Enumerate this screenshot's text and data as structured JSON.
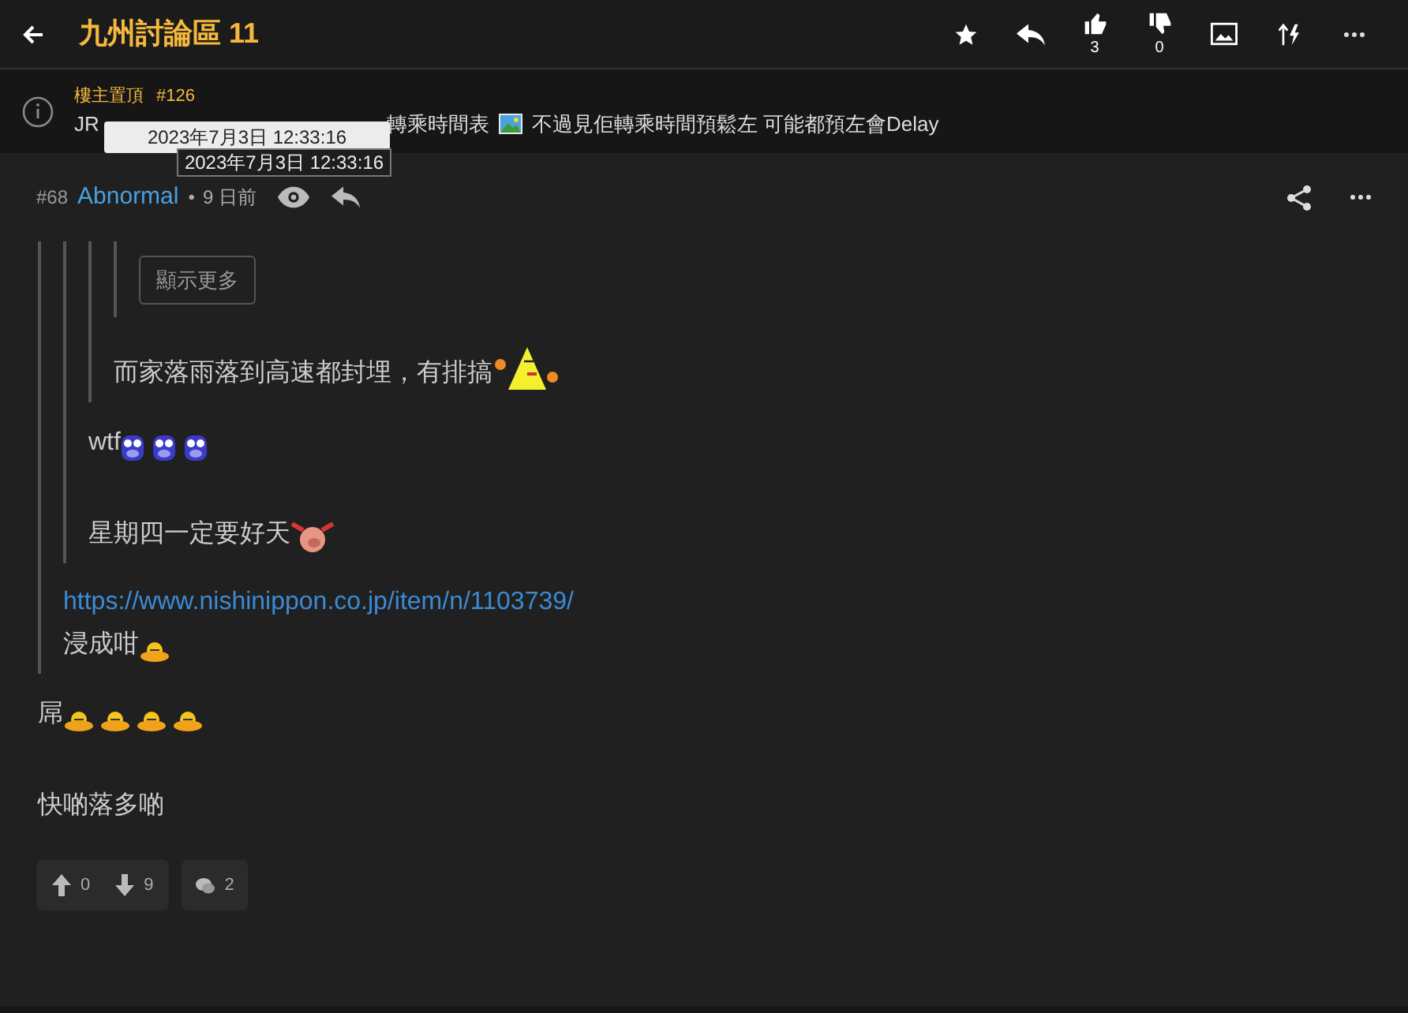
{
  "header": {
    "title": "九州討論區 11",
    "like_count": "3",
    "dislike_count": "0"
  },
  "pinned": {
    "label": "樓主置頂",
    "number": "#126",
    "text_start": "JR",
    "text_end_1": "轉乘時間表",
    "text_end_2": "不過見佢轉乘時間預鬆左 可能都預左會Delay"
  },
  "tooltips": [
    {
      "text": "2023年7月3日 12:33:16",
      "kind": "light"
    },
    {
      "text": "2023年7月3日 12:33:16",
      "kind": "dark"
    }
  ],
  "post": {
    "number": "#68",
    "author": "Abnormal",
    "separator": "•",
    "time": "9 日前",
    "blocks": [
      {
        "kind": "quote",
        "blocks": [
          {
            "kind": "quote",
            "blocks": [
              {
                "kind": "quote",
                "blocks": [
                  {
                    "kind": "quote",
                    "blocks": [
                      {
                        "kind": "button",
                        "label": "顯示更多"
                      }
                    ]
                  },
                  {
                    "kind": "text",
                    "text": "而家落雨落到高速都封埋，有排搞",
                    "emoji": [
                      {
                        "kind": "chick"
                      }
                    ]
                  }
                ]
              },
              {
                "kind": "text",
                "text": "wtf",
                "emoji": [
                  {
                    "kind": "face"
                  },
                  {
                    "kind": "face"
                  },
                  {
                    "kind": "face"
                  }
                ]
              },
              {
                "kind": "text",
                "text": "星期四一定要好天",
                "emoji": [
                  {
                    "kind": "pig"
                  }
                ]
              }
            ]
          },
          {
            "kind": "link",
            "text": "https://www.nishinippon.co.jp/item/n/1103739/"
          },
          {
            "kind": "text",
            "text": "浸成咁",
            "emoji": [
              {
                "kind": "duck"
              }
            ]
          }
        ]
      },
      {
        "kind": "text",
        "text": "屌",
        "emoji": [
          {
            "kind": "duck"
          },
          {
            "kind": "duck"
          },
          {
            "kind": "duck"
          },
          {
            "kind": "duck"
          }
        ]
      },
      {
        "kind": "text",
        "text": "快啲落多啲"
      }
    ],
    "upvotes": "0",
    "downvotes": "9",
    "replies": "2"
  }
}
